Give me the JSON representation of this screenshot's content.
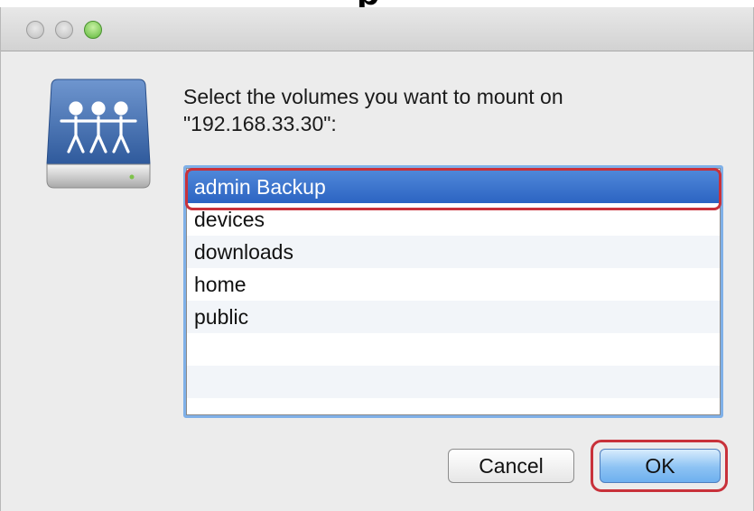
{
  "window": {
    "title": "",
    "controls": [
      "close",
      "minimize",
      "zoom"
    ],
    "colors": {
      "zoom": "#5fb83a",
      "selection": "#2c64c2",
      "callout": "#c8313a"
    }
  },
  "icon": {
    "name": "network-volume-icon"
  },
  "prompt": {
    "line1": "Select the volumes you want to mount on",
    "line2": "\"192.168.33.30\":"
  },
  "volumes": {
    "items": [
      "admin Backup",
      "devices",
      "downloads",
      "home",
      "public"
    ],
    "selected": "admin Backup"
  },
  "buttons": {
    "cancel_label": "Cancel",
    "ok_label": "OK"
  }
}
